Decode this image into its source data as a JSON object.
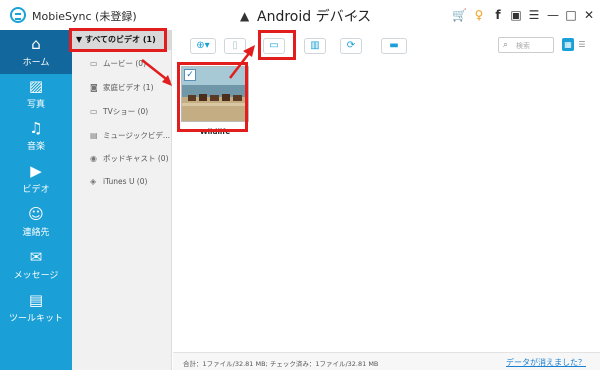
{
  "app": {
    "title": "MobieSync (未登録)"
  },
  "device": {
    "name": "Android デバイス"
  },
  "window_controls": {
    "cart": "🛒",
    "key": "♀",
    "facebook": "f",
    "chat": "▣",
    "menu": "☰",
    "minimize": "—",
    "maximize": "□",
    "close": "✕"
  },
  "sidebar": {
    "items": [
      {
        "label": "ホーム",
        "icon": "⌂"
      },
      {
        "label": "写真",
        "icon": "▨"
      },
      {
        "label": "音楽",
        "icon": "♫"
      },
      {
        "label": "ビデオ",
        "icon": "▶"
      },
      {
        "label": "連絡先",
        "icon": "☺"
      },
      {
        "label": "メッセージ",
        "icon": "✉"
      },
      {
        "label": "ツールキット",
        "icon": "▤"
      }
    ]
  },
  "categories": {
    "header": "▼ すべてのビデオ (1)",
    "items": [
      {
        "label": "ムービー (0)",
        "icon": "▭"
      },
      {
        "label": "家庭ビデオ (1)",
        "icon": "◙"
      },
      {
        "label": "TVショー (0)",
        "icon": "▭"
      },
      {
        "label": "ミュージックビデ...",
        "icon": "▤"
      },
      {
        "label": "ポッドキャスト (0)",
        "icon": "◉"
      },
      {
        "label": "iTunes U (0)",
        "icon": "◈"
      }
    ]
  },
  "toolbar": {
    "add": "⊕",
    "add_chevron": "▾",
    "export_device": "▯",
    "export_pc": "▭",
    "delete": "▥",
    "sync": "⟳",
    "toolbox": "▬"
  },
  "search": {
    "placeholder": "検索"
  },
  "views": {
    "grid": "▦",
    "list": "☰"
  },
  "media": {
    "name": "Wildlife",
    "checked": "✓"
  },
  "status": {
    "summary": "合計：1ファイル/32.81 MB; チェック済み：1ファイル/32.81 MB",
    "link": "データが消えました？"
  }
}
